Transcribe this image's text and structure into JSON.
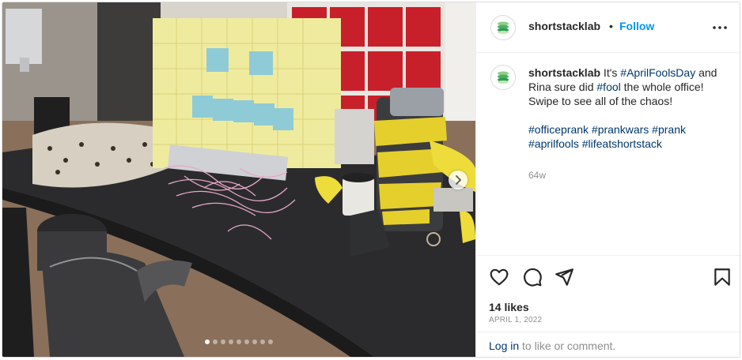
{
  "post": {
    "username": "shortstacklab",
    "separator": "•",
    "follow_label": "Follow",
    "caption": {
      "username": "shortstacklab",
      "line_start": " It's ",
      "tag1": "#AprilFoolsDay",
      "line_mid": " and Rina sure did ",
      "tag2": "#fool",
      "line_end": " the whole office! Swipe to see all of the chaos!",
      "hashtags": [
        "#officeprank",
        "#prankwars",
        "#prank",
        "#aprilfools",
        "#lifeatshortstack"
      ]
    },
    "time_ago": "64w",
    "likes": "14 likes",
    "date": "APRIL 1, 2022",
    "login_link": "Log in",
    "login_rest": " to like or comment."
  },
  "carousel": {
    "slide_count": 9,
    "active_index": 0
  },
  "icons": {
    "avatar": "stacked-pancakes-logo-icon",
    "more": "more-horizontal-icon",
    "like": "heart-icon",
    "comment": "comment-bubble-icon",
    "share": "paper-plane-icon",
    "save": "bookmark-icon",
    "next": "chevron-right-icon"
  },
  "colors": {
    "follow": "#0095f6",
    "hashtag": "#00376b",
    "muted": "#8e8e8e"
  }
}
